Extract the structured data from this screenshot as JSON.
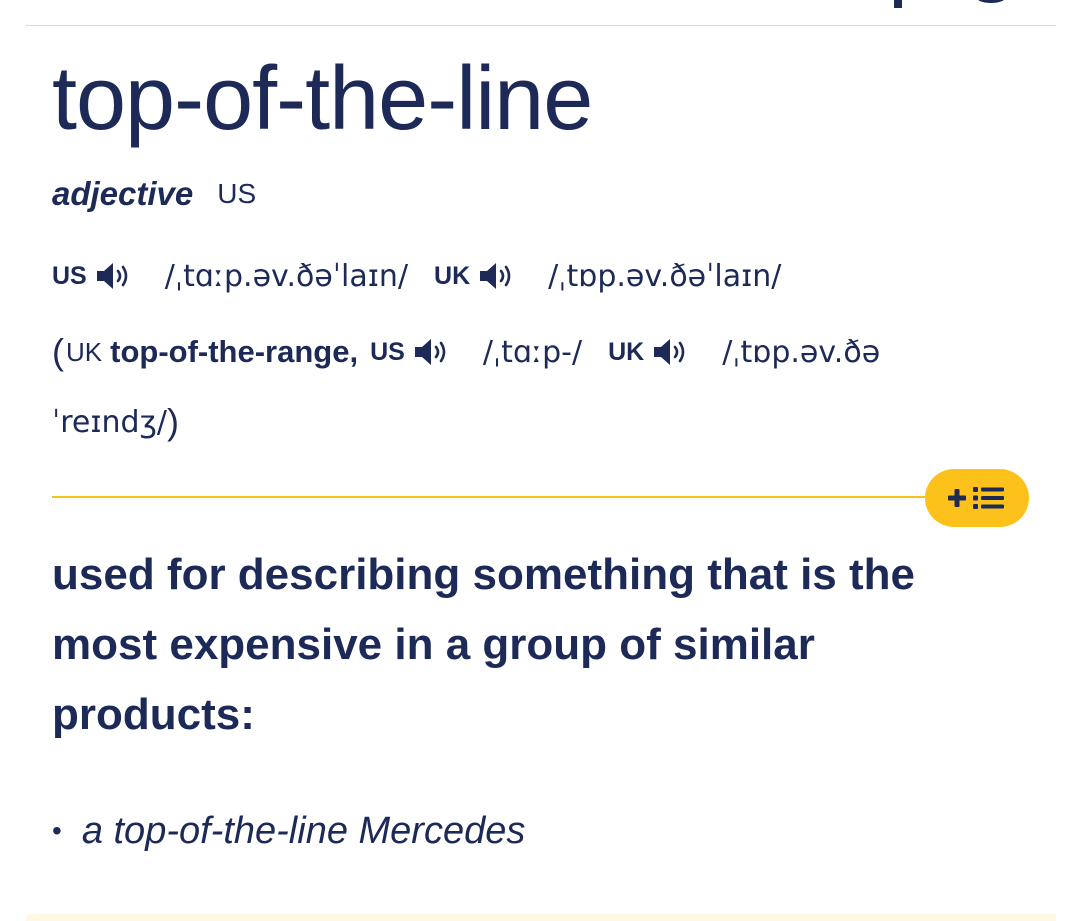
{
  "entry": {
    "headword": "top-of-the-line",
    "part_of_speech": "adjective",
    "usage_region": "US"
  },
  "pronunciations": {
    "us_label": "US",
    "us_ipa": "/ˌtɑːp.əv.ðəˈlaɪn/",
    "uk_label": "UK",
    "uk_ipa": "/ˌtɒp.əv.ðəˈlaɪn/"
  },
  "variant": {
    "open_paren": "(",
    "region": "UK",
    "word": "top-of-the-range,",
    "us_label": "US",
    "us_ipa": "/ˌtɑːp-/",
    "uk_label": "UK",
    "uk_ipa_line1": "/ˌtɒp.əv.ðə",
    "uk_ipa_line2": "ˈreɪndʒ/",
    "close_paren": ")"
  },
  "sense": {
    "definition": "used for describing something that is the most expensive in a group of similar products:",
    "example_bullet": "•",
    "example": "a top-of-the-line Mercedes"
  },
  "icons": {
    "speaker": "speaker-icon",
    "add_to_list": "add-to-word-list-icon"
  },
  "colors": {
    "text": "#1d2a57",
    "accent_yellow": "#fcc21b",
    "rule_yellow": "#f5c518"
  }
}
